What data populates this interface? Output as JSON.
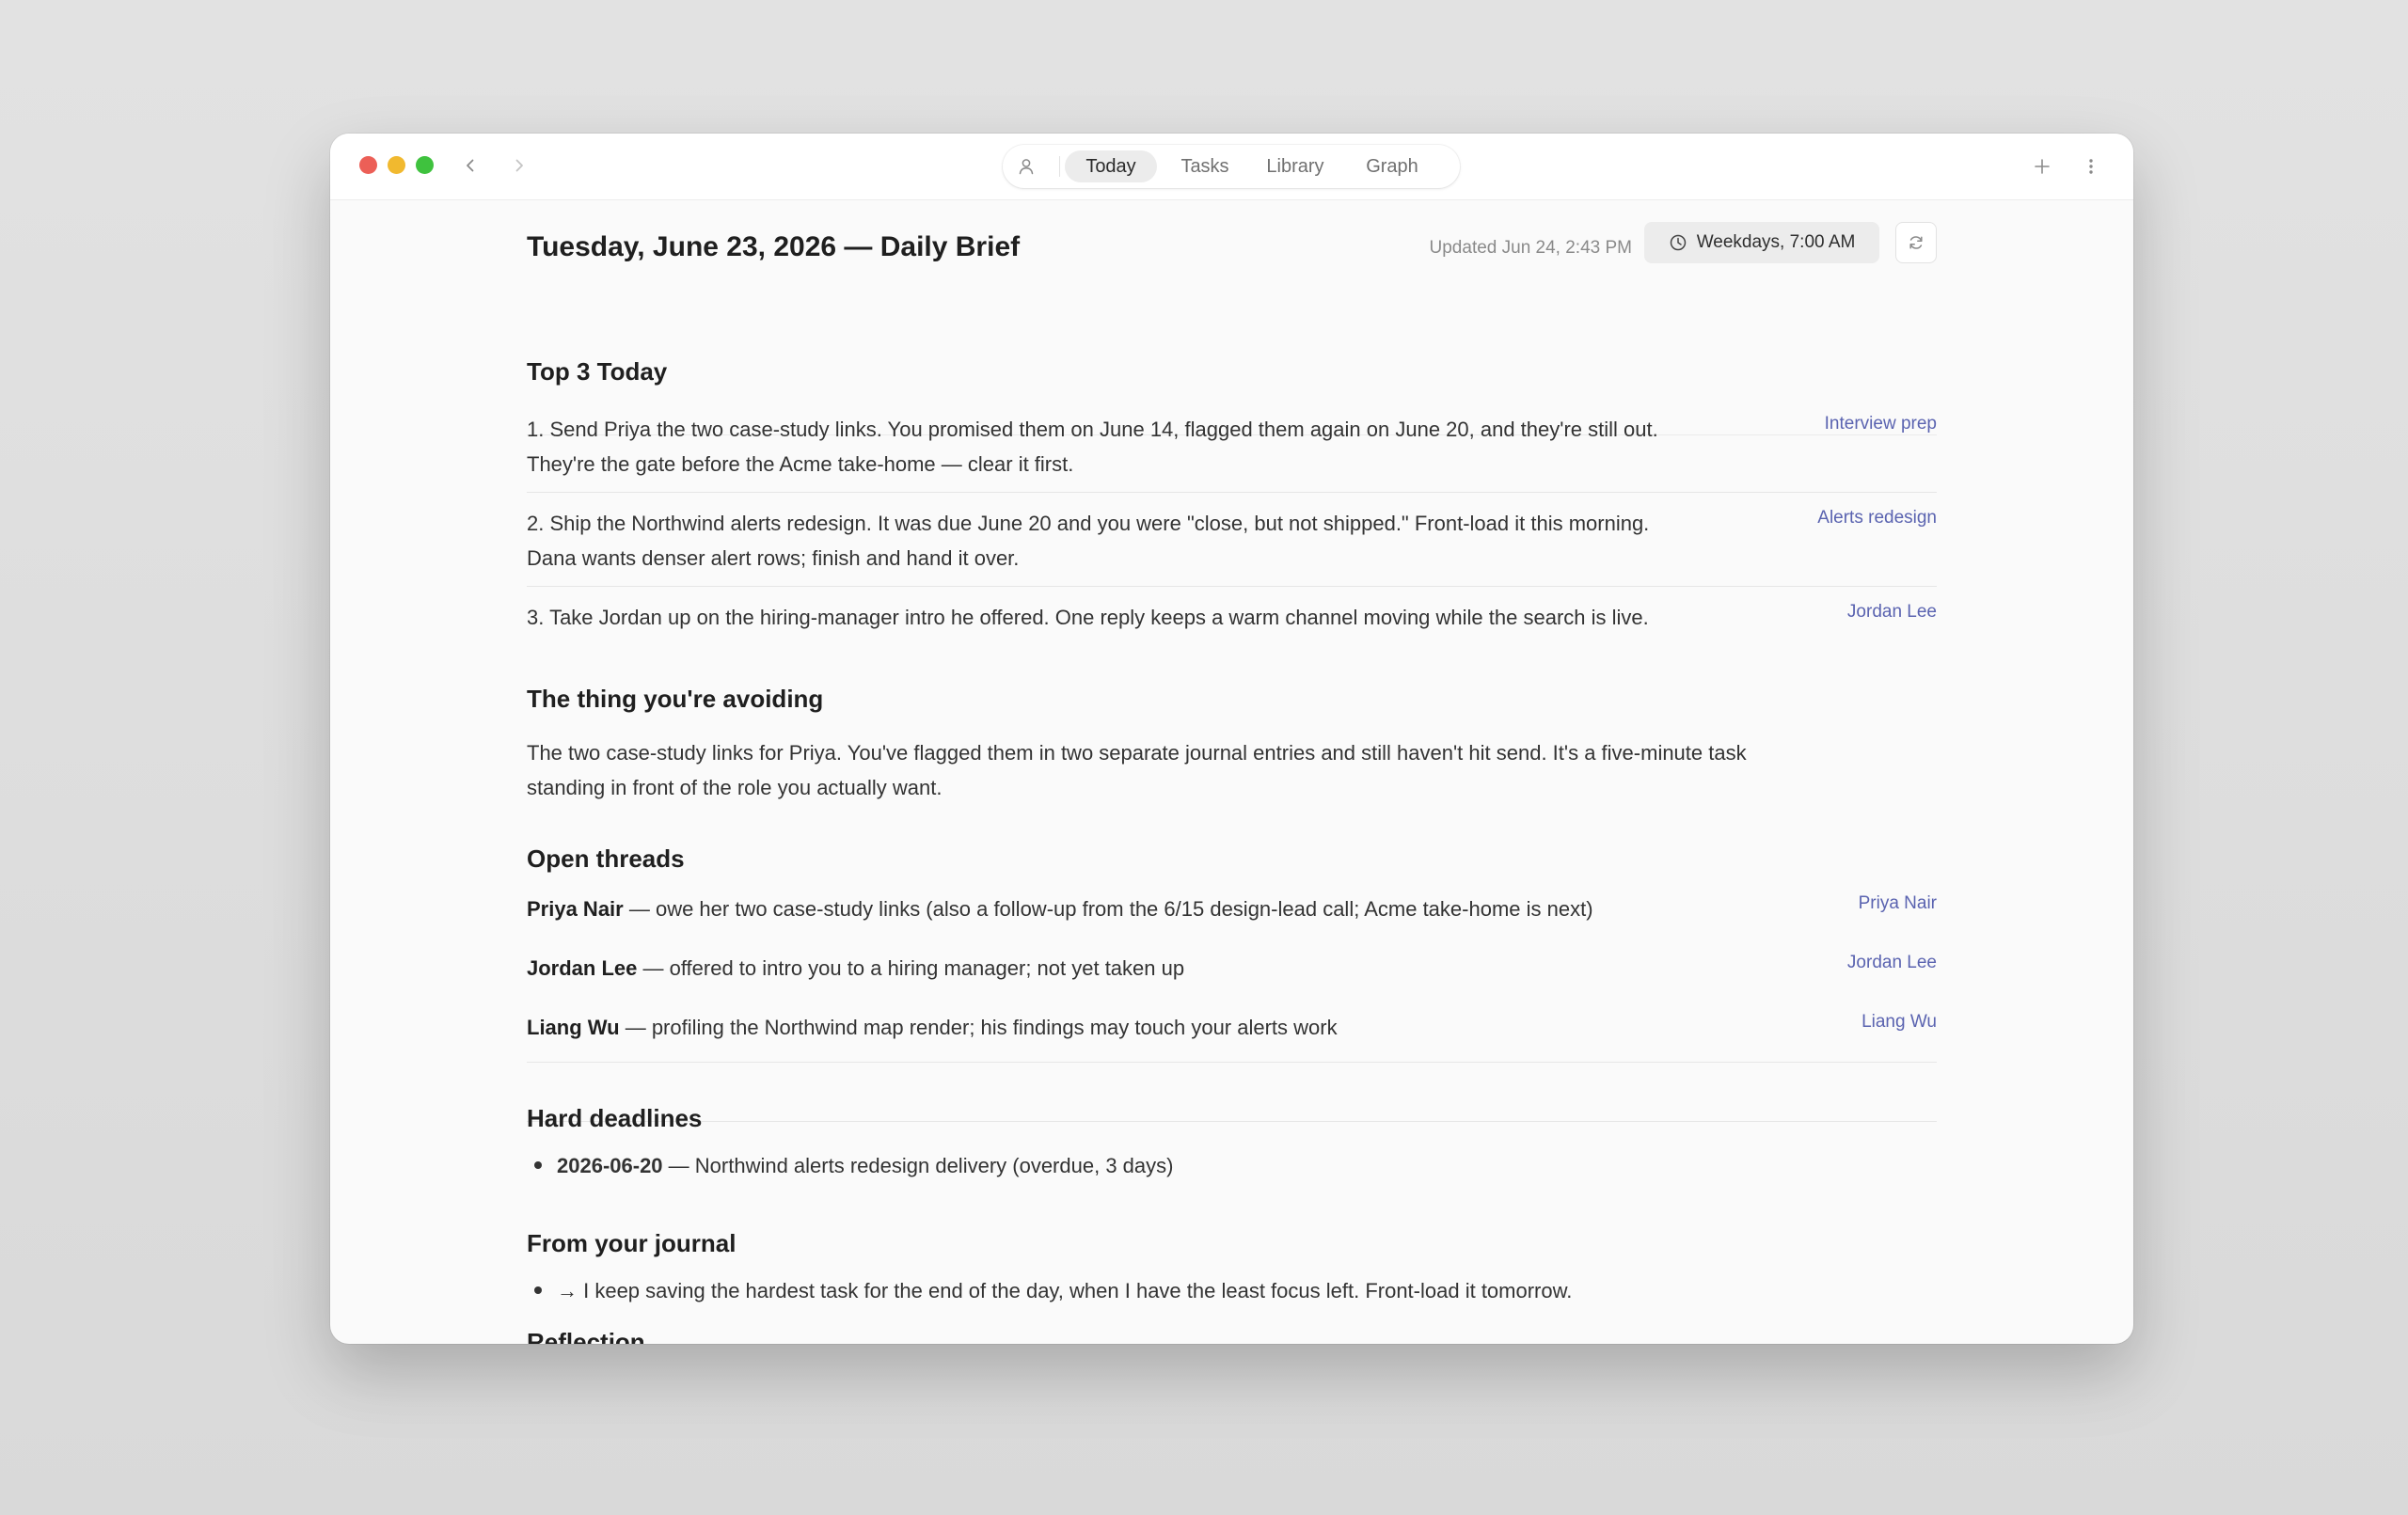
{
  "window": {
    "tabs": [
      {
        "label": "Today",
        "active": true
      },
      {
        "label": "Tasks",
        "active": false
      },
      {
        "label": "Library",
        "active": false
      },
      {
        "label": "Graph",
        "active": false
      }
    ],
    "icons": {
      "back": "chevron-left-icon",
      "forward": "chevron-right-icon",
      "profile": "user-icon",
      "new": "plus-icon",
      "more": "more-vertical-icon",
      "schedule": "clock-icon",
      "refresh": "refresh-icon"
    }
  },
  "brief": {
    "title": "Tuesday, June 23, 2026 — Daily Brief",
    "updated": "Updated Jun 24, 2:43 PM",
    "schedule": "Weekdays, 7:00 AM"
  },
  "top3": {
    "heading": "Top 3 Today",
    "items": [
      {
        "text_line1": "1. Send Priya the two case-study links. You promised them on June 14, flagged them again on June 20, and they're still out.",
        "text_line2": "They're the gate before the Acme take-home — clear it first.",
        "link": "Interview prep"
      },
      {
        "text_line1": "2. Ship the Northwind alerts redesign. It was due June 20 and you were \"close, but not shipped.\" Front-load it this morning.",
        "text_line2": "Dana wants denser alert rows; finish and hand it over.",
        "link": "Alerts redesign"
      },
      {
        "text_line1": "3. Take Jordan up on the hiring-manager intro he offered. One reply keeps a warm channel moving while the search is live.",
        "text_line2": "",
        "link": "Jordan Lee"
      }
    ]
  },
  "avoiding": {
    "heading": "The thing you're avoiding",
    "line1": "The two case-study links for Priya. You've flagged them in two separate journal entries and still haven't hit send. It's a five-minute task",
    "line2": "standing in front of the role you actually want."
  },
  "threads": {
    "heading": "Open threads",
    "items": [
      {
        "name": "Priya Nair",
        "text": " — owe her two case-study links (also a follow-up from the 6/15 design-lead call; Acme take-home is next)",
        "link": "Priya Nair"
      },
      {
        "name": "Jordan Lee",
        "text": " — offered to intro you to a hiring manager; not yet taken up",
        "link": "Jordan Lee"
      },
      {
        "name": "Liang Wu",
        "text": " — profiling the Northwind map render; his findings may touch your alerts work",
        "link": "Liang Wu"
      }
    ]
  },
  "deadlines": {
    "heading": "Hard deadlines",
    "items": [
      {
        "date": "2026-06-20",
        "text": " — Northwind alerts redesign delivery (overdue, 3 days)"
      }
    ]
  },
  "journal": {
    "heading": "From your journal",
    "items": [
      {
        "text": "→ I keep saving the hardest task for the end of the day, when I have the least focus left. Front-load it tomorrow."
      }
    ]
  },
  "reflection": {
    "heading": "Reflection"
  },
  "colors": {
    "accent_link": "#5a63b0",
    "close": "#ec5f57",
    "minimize": "#f1b92f",
    "maximize": "#3fc23e"
  }
}
